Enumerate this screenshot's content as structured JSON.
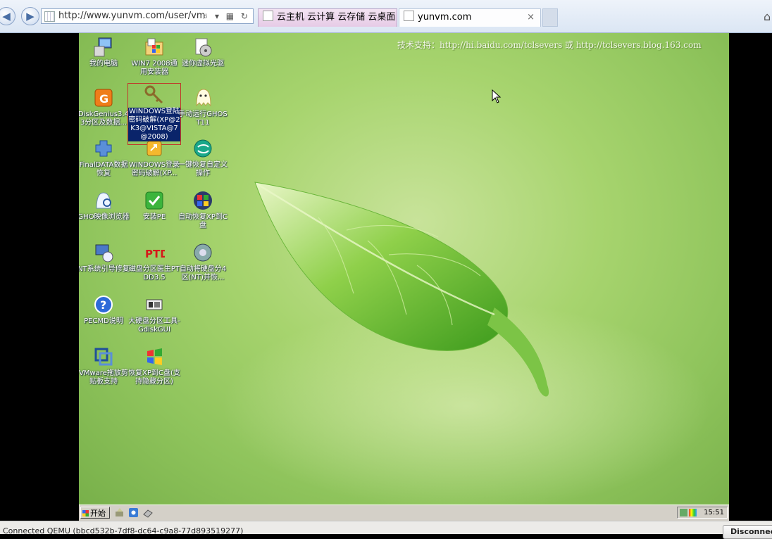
{
  "browser": {
    "address_url": "http://www.yunvm.com/user/vms/co",
    "address_tools": "⌕ ▾ ▦ ↻",
    "tabs": [
      {
        "label": "云主机 云计算 云存储 云桌面 ...",
        "active": false
      },
      {
        "label": "yunvm.com",
        "active": true
      }
    ],
    "tab_close": "×"
  },
  "desktop": {
    "support_text": "技术支持：http://hi.baidu.com/tclsevers 或 http://tclsevers.blog.163.com",
    "icons": [
      {
        "label": "我的电脑",
        "icon": "computer-icon"
      },
      {
        "label": "WIN7 2008通用安装器",
        "icon": "installer-icon"
      },
      {
        "label": "迷你虚拟光驱",
        "icon": "virtual-drive-icon"
      },
      {
        "label": "DiskGenius3.43分区及数据...",
        "icon": "diskgenius-icon"
      },
      {
        "label": "WINDOWS登陆密码破解(XP@2K3@VISTA@7@2008)",
        "icon": "key-icon",
        "selected": true
      },
      {
        "label": "手动运行GHOST11",
        "icon": "ghost-icon"
      },
      {
        "label": "FinalDATA数据恢复",
        "icon": "finaldata-icon"
      },
      {
        "label": "WINDOWS登录密码破解(XP...",
        "icon": "password-icon"
      },
      {
        "label": "一键恢复自定义操作",
        "icon": "restore-icon"
      },
      {
        "label": "GHO映像浏览器",
        "icon": "gho-viewer-icon"
      },
      {
        "label": "安装PE",
        "icon": "checkmark-icon"
      },
      {
        "label": "自动恢复XP到C盘",
        "icon": "windows-xp-icon"
      },
      {
        "label": "NT系统引导修复",
        "icon": "boot-repair-icon"
      },
      {
        "label": "磁盘分区医生PTDD3.5",
        "icon": "ptdd-icon"
      },
      {
        "label": "自动将硬盘分4区(NT)并恢...",
        "icon": "hdd-partition-icon"
      },
      {
        "label": "PECMD说明",
        "icon": "help-icon"
      },
      {
        "label": "大硬盘分区工具-GdiskGUI",
        "icon": "gdisk-icon"
      },
      {
        "label": "VMware拖放剪贴板支持",
        "icon": "vmware-icon"
      },
      {
        "label": "恢复XP到C盘(支持隐藏分区)",
        "icon": "windows-xp-icon"
      }
    ]
  },
  "taskbar": {
    "start_label": "开始",
    "clock": "15:51"
  },
  "statusbar": {
    "text": "Connected QEMU (bbcd532b-7df8-dc64-c9a8-77d893519277)",
    "disconnect_label": "Disconnect"
  },
  "colors": {
    "desktop_green": "#a7d46e",
    "selection_blue": "#0a246a",
    "taskbar_gray": "#d4d0c8"
  }
}
